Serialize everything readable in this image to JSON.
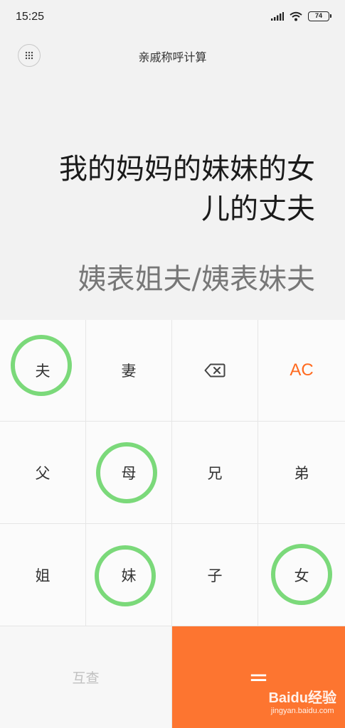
{
  "status_bar": {
    "time": "15:25",
    "battery_level": "74",
    "icons": [
      "signal-icon",
      "wifi-icon",
      "battery-icon"
    ]
  },
  "header": {
    "title": "亲戚称呼计算",
    "menu_icon": "grid-dots-icon"
  },
  "display": {
    "expression_line1": "我的妈妈的妹妹的女",
    "expression_line2": "儿的丈夫",
    "result": "姨表姐夫/姨表妹夫"
  },
  "keypad": {
    "row1": [
      "夫",
      "妻",
      "⌫",
      "AC"
    ],
    "row2": [
      "父",
      "母",
      "兄",
      "弟"
    ],
    "row3": [
      "姐",
      "妹",
      "子",
      "女"
    ],
    "swap_label": "互查",
    "equals_label": "=",
    "highlighted_keys": [
      "夫",
      "母",
      "妹",
      "女"
    ],
    "highlight_color": "#7bd97a",
    "accent_color": "#fd7530"
  },
  "watermark": {
    "brand": "Baidu经验",
    "domain": "jingyan.baidu.com"
  }
}
